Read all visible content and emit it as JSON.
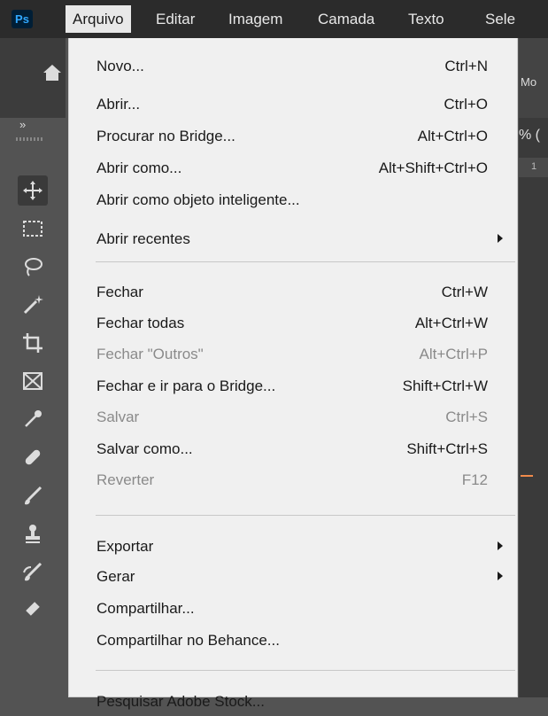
{
  "app": {
    "logo": "Ps"
  },
  "menubar": {
    "items": [
      "Arquivo",
      "Editar",
      "Imagem",
      "Camada",
      "Texto",
      "Sele"
    ]
  },
  "right_area": {
    "options_label": "Mo",
    "zoom_fragment": "% (",
    "ruler_tick": "1"
  },
  "file_menu": {
    "items": [
      {
        "label": "Novo...",
        "shortcut": "Ctrl+N",
        "disabled": false
      },
      {
        "label": "Abrir...",
        "shortcut": "Ctrl+O",
        "disabled": false
      },
      {
        "label": "Procurar no Bridge...",
        "shortcut": "Alt+Ctrl+O",
        "disabled": false
      },
      {
        "label": "Abrir como...",
        "shortcut": "Alt+Shift+Ctrl+O",
        "disabled": false
      },
      {
        "label": "Abrir como objeto inteligente...",
        "shortcut": "",
        "disabled": false
      },
      {
        "label": "Abrir recentes",
        "shortcut": "",
        "disabled": false,
        "submenu": true
      },
      {
        "label": "Fechar",
        "shortcut": "Ctrl+W",
        "disabled": false
      },
      {
        "label": "Fechar todas",
        "shortcut": "Alt+Ctrl+W",
        "disabled": false
      },
      {
        "label": "Fechar \"Outros\"",
        "shortcut": "Alt+Ctrl+P",
        "disabled": true
      },
      {
        "label": "Fechar e ir para o Bridge...",
        "shortcut": "Shift+Ctrl+W",
        "disabled": false
      },
      {
        "label": "Salvar",
        "shortcut": "Ctrl+S",
        "disabled": true
      },
      {
        "label": "Salvar como...",
        "shortcut": "Shift+Ctrl+S",
        "disabled": false
      },
      {
        "label": "Reverter",
        "shortcut": "F12",
        "disabled": true
      },
      {
        "label": "Exportar",
        "shortcut": "",
        "disabled": false,
        "submenu": true
      },
      {
        "label": "Gerar",
        "shortcut": "",
        "disabled": false,
        "submenu": true
      },
      {
        "label": "Compartilhar...",
        "shortcut": "",
        "disabled": false
      },
      {
        "label": "Compartilhar no Behance...",
        "shortcut": "",
        "disabled": false
      },
      {
        "label": "Pesquisar Adobe Stock...",
        "shortcut": "",
        "disabled": false
      }
    ]
  },
  "toolbox": {
    "tools": [
      "move-icon",
      "marquee-icon",
      "lasso-icon",
      "magic-wand-icon",
      "crop-icon",
      "frame-icon",
      "eyedropper-icon",
      "healing-icon",
      "brush-icon",
      "stamp-icon",
      "history-brush-icon",
      "eraser-icon"
    ]
  },
  "colors": {
    "menu_bg": "#f0f0f0",
    "chrome_dark": "#2b2b2b",
    "accent": "#f08a4b",
    "ps_blue": "#31a8ff"
  }
}
